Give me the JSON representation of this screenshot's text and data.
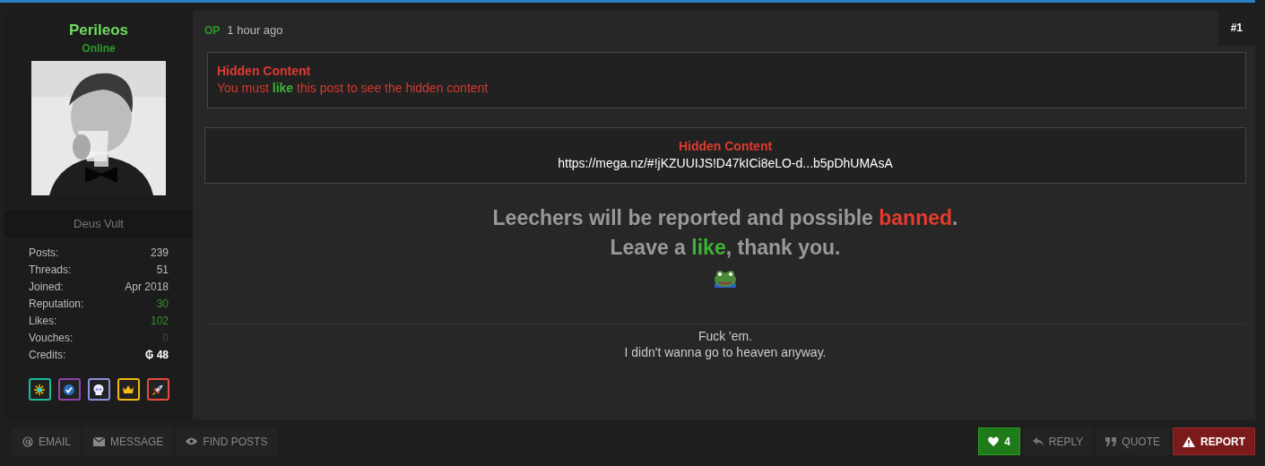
{
  "user": {
    "name": "Perileos",
    "status": "Online",
    "user_title": "Deus Vult",
    "stats": [
      {
        "label": "Posts:",
        "value": "239",
        "kind": "plain"
      },
      {
        "label": "Threads:",
        "value": "51",
        "kind": "plain"
      },
      {
        "label": "Joined:",
        "value": "Apr 2018",
        "kind": "plain"
      },
      {
        "label": "Reputation:",
        "value": "30",
        "kind": "good"
      },
      {
        "label": "Likes:",
        "value": "102",
        "kind": "good"
      },
      {
        "label": "Vouches:",
        "value": "0",
        "kind": "muted"
      },
      {
        "label": "Credits:",
        "value": "₲ 48",
        "kind": "strong"
      }
    ],
    "badges": [
      {
        "kind": "sparkle",
        "color": "#1abc9c"
      },
      {
        "kind": "check",
        "color": "#8e44ad"
      },
      {
        "kind": "skull",
        "color": "#8c8fe0"
      },
      {
        "kind": "crown",
        "color": "#f1b90f"
      },
      {
        "kind": "rocket",
        "color": "#e74c3c"
      }
    ]
  },
  "post": {
    "op_label": "OP",
    "time": "1 hour ago",
    "number": "#1",
    "hidden_notice": {
      "title": "Hidden Content",
      "text": "You must **like** this post to see the hidden content"
    },
    "hidden_link": {
      "title": "Hidden Content",
      "link": "https://mega.nz/#!jKZUUIJS!D47kICi8eLO-d...b5pDhUMAsA"
    },
    "message": [
      {
        "text": "Leechers will be reported and possible **banned**.",
        "kind": "danger"
      },
      {
        "text": "Leave a **like**, thank you.",
        "kind": "success"
      }
    ],
    "signature": [
      "Fuck 'em.",
      "I didn't wanna go to heaven anyway."
    ]
  },
  "footer": {
    "left": [
      {
        "kind": "email",
        "label": "EMAIL"
      },
      {
        "kind": "message",
        "label": "MESSAGE"
      },
      {
        "kind": "find",
        "label": "FIND POSTS"
      }
    ],
    "right": [
      {
        "kind": "like",
        "label": "4"
      },
      {
        "kind": "reply",
        "label": "REPLY"
      },
      {
        "kind": "quote",
        "label": "QUOTE"
      },
      {
        "kind": "report",
        "label": "REPORT"
      }
    ]
  }
}
